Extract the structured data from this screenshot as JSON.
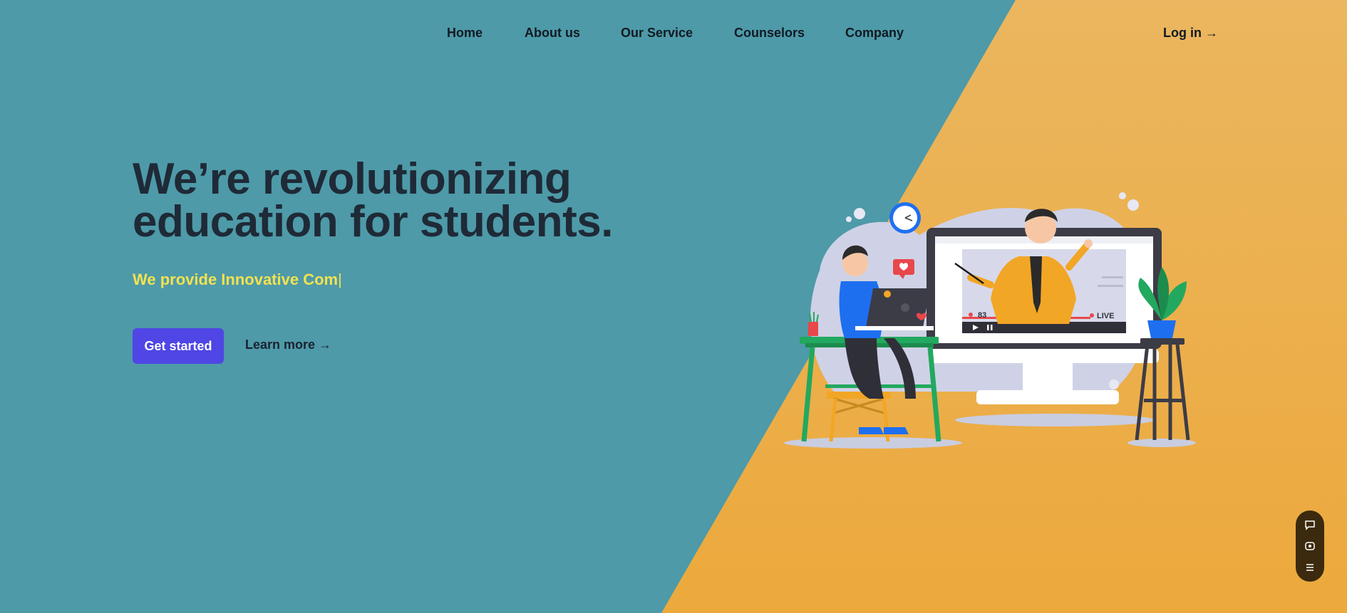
{
  "nav": {
    "items": [
      "Home",
      "About us",
      "Our Service",
      "Counselors",
      "Company"
    ],
    "login": "Log in →"
  },
  "hero": {
    "title_line1": "We’re revolutionizing",
    "title_line2": "education for students.",
    "typed_subtitle": "We provide Innovative Com",
    "cursor": "|",
    "cta_primary": "Get started",
    "cta_secondary": "Learn more →"
  },
  "illustration": {
    "viewer_count": "83",
    "live_label": "LIVE"
  },
  "widget": {
    "icons": [
      "chat-icon",
      "eye-icon",
      "menu-icon"
    ]
  },
  "colors": {
    "teal_bg": "#4e9aa8",
    "orange_bg": "#ebb04a",
    "title": "#1f2a37",
    "subtitle": "#f3e24f",
    "primary_button": "#4f46e5"
  }
}
